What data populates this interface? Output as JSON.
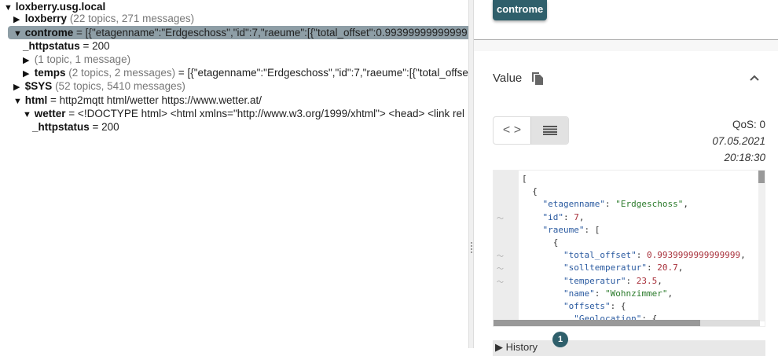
{
  "tree": [
    {
      "indent": 0,
      "expanded": "▼",
      "key": "loxberry.usg.local",
      "meta": "",
      "value": ""
    },
    {
      "indent": 1,
      "expanded": "▶",
      "key": "loxberry",
      "meta": "(22 topics, 271 messages)",
      "value": ""
    },
    {
      "indent": 1,
      "expanded": "▼",
      "key": "controme",
      "meta": "",
      "value": "= [{\"etagenname\":\"Erdgeschoss\",\"id\":7,\"raeume\":[{\"total_offset\":0.99399999999999",
      "selected": true
    },
    {
      "indent": 2,
      "expanded": "",
      "key": "_httpstatus",
      "meta": "",
      "value": "= 200"
    },
    {
      "indent": 2,
      "expanded": "▶",
      "key": "",
      "meta": "(1 topic, 1 message)",
      "value": ""
    },
    {
      "indent": 2,
      "expanded": "▶",
      "key": "temps",
      "meta": "(2 topics, 2 messages)",
      "value": "= [{\"etagenname\":\"Erdgeschoss\",\"id\":7,\"raeume\":[{\"total_offset"
    },
    {
      "indent": 1,
      "expanded": "▶",
      "key": "$SYS",
      "meta": "(52 topics, 5410 messages)",
      "value": ""
    },
    {
      "indent": 1,
      "expanded": "▼",
      "key": "html",
      "meta": "",
      "value": "= http2mqtt html/wetter https://www.wetter.at/"
    },
    {
      "indent": 2,
      "expanded": "▼",
      "key": "wetter",
      "meta": "",
      "value": "= <!DOCTYPE html> <html xmlns=\"http://www.w3.org/1999/xhtml\"> <head> <link rel"
    },
    {
      "indent": 3,
      "expanded": "",
      "key": "_httpstatus",
      "meta": "",
      "value": "= 200"
    }
  ],
  "detail": {
    "topic_chip": "controme",
    "value_label": "Value",
    "qos": "QoS: 0",
    "date": "07.05.2021",
    "time": "20:18:30",
    "history_label": "History",
    "history_count": "1",
    "accent": "#2f5f6b"
  },
  "code_lines": [
    {
      "t": "[",
      "spark": false
    },
    {
      "t": "  {",
      "spark": false
    },
    {
      "t": "    \"etagenname\": \"Erdgeschoss\",",
      "spark": false
    },
    {
      "t": "    \"id\": 7,",
      "spark": true
    },
    {
      "t": "    \"raeume\": [",
      "spark": false
    },
    {
      "t": "      {",
      "spark": false
    },
    {
      "t": "        \"total_offset\": 0.9939999999999999,",
      "spark": true
    },
    {
      "t": "        \"solltemperatur\": 20.7,",
      "spark": true
    },
    {
      "t": "        \"temperatur\": 23.5,",
      "spark": true
    },
    {
      "t": "        \"name\": \"Wohnzimmer\",",
      "spark": false
    },
    {
      "t": "        \"offsets\": {",
      "spark": false
    },
    {
      "t": "          \"Geolocation\": {",
      "spark": false
    }
  ]
}
